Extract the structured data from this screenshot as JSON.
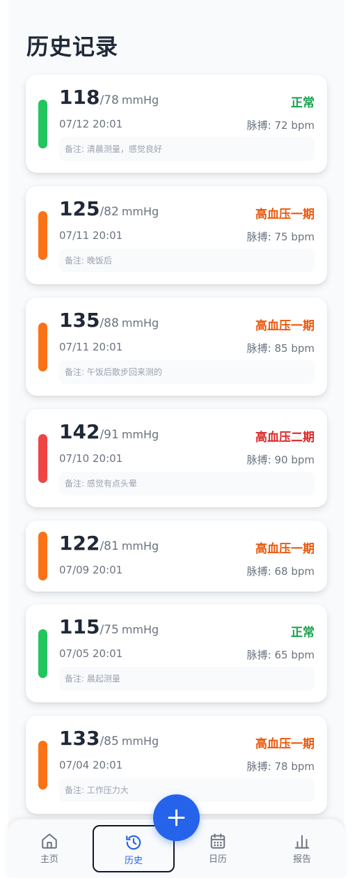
{
  "page": {
    "title": "历史记录"
  },
  "records": [
    {
      "systolic": "118",
      "diastolic": "/78",
      "unit": "mmHg",
      "status": "正常",
      "status_color": "#16a34a",
      "bar_color": "#22c55e",
      "datetime": "07/12 20:01",
      "pulse": "脉搏: 72 bpm",
      "note": "备注: 清晨测量，感觉良好"
    },
    {
      "systolic": "125",
      "diastolic": "/82",
      "unit": "mmHg",
      "status": "高血压一期",
      "status_color": "#ea580c",
      "bar_color": "#f97316",
      "datetime": "07/11 20:01",
      "pulse": "脉搏: 75 bpm",
      "note": "备注: 晚饭后"
    },
    {
      "systolic": "135",
      "diastolic": "/88",
      "unit": "mmHg",
      "status": "高血压一期",
      "status_color": "#ea580c",
      "bar_color": "#f97316",
      "datetime": "07/11 20:01",
      "pulse": "脉搏: 85 bpm",
      "note": "备注: 午饭后散步回来测的"
    },
    {
      "systolic": "142",
      "diastolic": "/91",
      "unit": "mmHg",
      "status": "高血压二期",
      "status_color": "#dc2626",
      "bar_color": "#ef4444",
      "datetime": "07/10 20:01",
      "pulse": "脉搏: 90 bpm",
      "note": "备注: 感觉有点头晕"
    },
    {
      "systolic": "122",
      "diastolic": "/81",
      "unit": "mmHg",
      "status": "高血压一期",
      "status_color": "#ea580c",
      "bar_color": "#f97316",
      "datetime": "07/09 20:01",
      "pulse": "脉搏: 68 bpm",
      "note": ""
    },
    {
      "systolic": "115",
      "diastolic": "/75",
      "unit": "mmHg",
      "status": "正常",
      "status_color": "#16a34a",
      "bar_color": "#22c55e",
      "datetime": "07/05 20:01",
      "pulse": "脉搏: 65 bpm",
      "note": "备注: 晨起测量"
    },
    {
      "systolic": "133",
      "diastolic": "/85",
      "unit": "mmHg",
      "status": "高血压一期",
      "status_color": "#ea580c",
      "bar_color": "#f97316",
      "datetime": "07/04 20:01",
      "pulse": "脉搏: 78 bpm",
      "note": "备注: 工作压力大"
    }
  ],
  "nav": {
    "home": "主页",
    "history": "历史",
    "calendar": "日历",
    "report": "报告",
    "active_color": "#2563eb"
  },
  "fab": {
    "icon": "plus-icon"
  }
}
